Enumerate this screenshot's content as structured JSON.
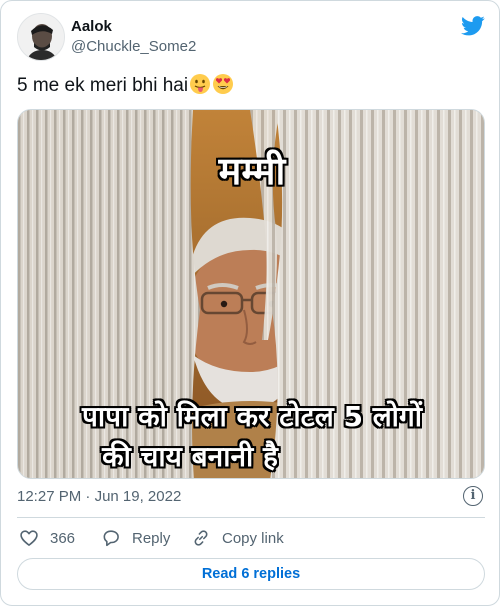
{
  "tweet": {
    "author_name": "Aalok",
    "author_handle": "@Chuckle_Some2",
    "text": "5 me ek meri bhi hai",
    "emojis": [
      "face-with-tongue-emoji",
      "heart-eyes-emoji"
    ],
    "media": {
      "caption_top": "मम्मी",
      "caption_bottom_line1": "पापा को मिला कर टोटल 5 लोगों",
      "caption_bottom_line2": "की चाय बनानी है"
    },
    "time": "12:27 PM",
    "separator": "·",
    "date": "Jun 19, 2022"
  },
  "actions": {
    "like_count": "366",
    "reply_label": "Reply",
    "copy_label": "Copy link"
  },
  "read_replies_label": "Read 6 replies",
  "icons": {
    "brand": "twitter-bird-icon",
    "info": "info-icon",
    "like": "heart-icon",
    "reply": "reply-bubble-icon",
    "copy": "link-icon"
  },
  "colors": {
    "brand_blue": "#1d9bf0",
    "link_blue": "#006fd6",
    "secondary_text": "#536471",
    "border": "#cfd9de",
    "like_red": "#f91880"
  }
}
